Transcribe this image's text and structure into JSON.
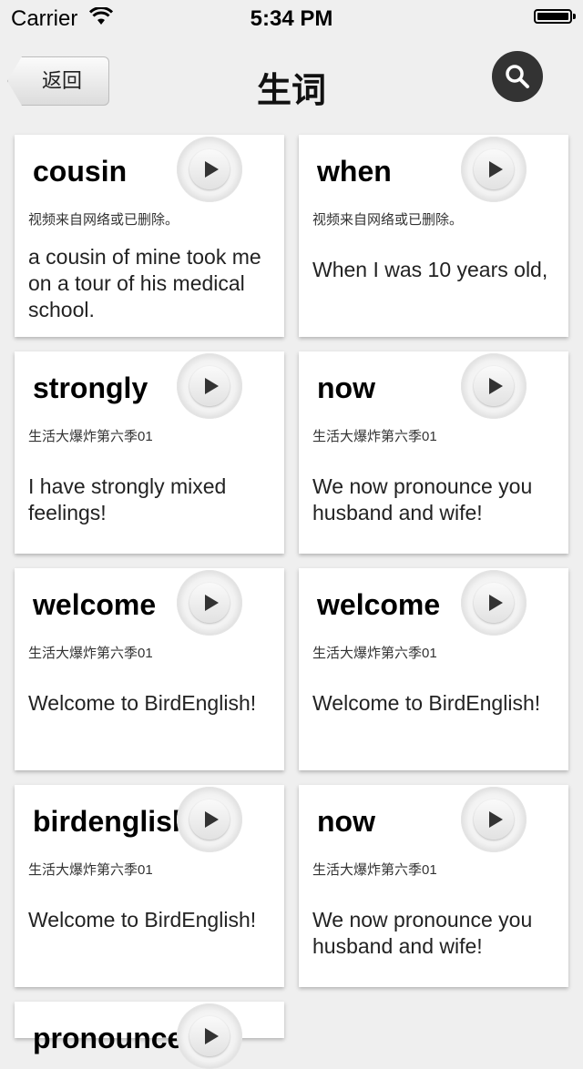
{
  "status_bar": {
    "carrier": "Carrier",
    "time": "5:34 PM"
  },
  "nav": {
    "back_label": "返回",
    "title": "生词"
  },
  "cards": [
    {
      "word": "cousin",
      "source": "视频来自网络或已删除。",
      "sentence": "a cousin of mine took me on a tour of his medical school."
    },
    {
      "word": "when",
      "source": "视频来自网络或已删除。",
      "sentence": "When I was 10 years old,"
    },
    {
      "word": "strongly",
      "source": "生活大爆炸第六季01",
      "sentence": "I have strongly mixed feelings!"
    },
    {
      "word": "now",
      "source": "生活大爆炸第六季01",
      "sentence": "We now pronounce you husband and wife!"
    },
    {
      "word": "welcome",
      "source": "生活大爆炸第六季01",
      "sentence": "Welcome to BirdEnglish!"
    },
    {
      "word": "welcome",
      "source": "生活大爆炸第六季01",
      "sentence": "Welcome to BirdEnglish!"
    },
    {
      "word": "birdenglish",
      "source": "生活大爆炸第六季01",
      "sentence": "Welcome to BirdEnglish!"
    },
    {
      "word": "now",
      "source": "生活大爆炸第六季01",
      "sentence": "We now pronounce you husband and wife!"
    },
    {
      "word": "pronounce",
      "source": "",
      "sentence": ""
    }
  ]
}
